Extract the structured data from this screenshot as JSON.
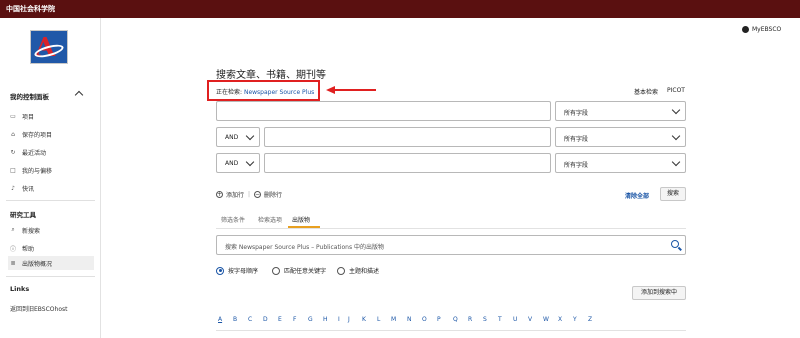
{
  "topbar": {
    "title": "中国社会科学院"
  },
  "sidebar": {
    "sections": [
      {
        "title": "我的控制面板",
        "items": [
          {
            "icon": "list-icon",
            "label": "项目"
          },
          {
            "icon": "bookmark-icon",
            "label": "保存的项目"
          },
          {
            "icon": "history-icon",
            "label": "最近活动"
          },
          {
            "icon": "folder-icon",
            "label": "我的与偏移"
          },
          {
            "icon": "bell-icon",
            "label": "快讯"
          }
        ]
      },
      {
        "title": "研究工具",
        "items": [
          {
            "icon": "search-icon",
            "label": "新搜索"
          },
          {
            "icon": "help-icon",
            "label": "帮助"
          },
          {
            "icon": "publications-icon",
            "label": "出版物概况"
          }
        ]
      }
    ],
    "links_title": "Links",
    "links": [
      "返回到旧EBSCOhost"
    ]
  },
  "header": {
    "myebsco": "MyEBSCO"
  },
  "main": {
    "title": "搜索文章、书籍、期刊等",
    "searching_label": "正在检索:",
    "database": "Newspaper Source Plus",
    "basic_search": "基本检索",
    "picot": "PICOT",
    "rows": [
      {
        "operator": "",
        "text": "",
        "field": "所有字段"
      },
      {
        "operator": "AND",
        "text": "",
        "field": "所有字段"
      },
      {
        "operator": "AND",
        "text": "",
        "field": "所有字段"
      }
    ],
    "add_row": "添加行",
    "remove_row": "删除行",
    "clear_all": "清除全部",
    "search_button": "搜索",
    "tabs": [
      "筛选条件",
      "检索选项",
      "出版物"
    ],
    "pub_search_placeholder": "搜索 Newspaper Source Plus – Publications 中的出版物",
    "radios": [
      "按字母顺序",
      "匹配任意关键字",
      "主题和描述"
    ],
    "add_to_search": "添加到搜索中",
    "alphabet": [
      "A",
      "B",
      "C",
      "D",
      "E",
      "F",
      "G",
      "H",
      "I",
      "J",
      "K",
      "L",
      "M",
      "N",
      "O",
      "P",
      "Q",
      "R",
      "S",
      "T",
      "U",
      "V",
      "W",
      "X",
      "Y",
      "Z"
    ]
  },
  "colors": {
    "topbar": "#5a1010",
    "accent": "#1a55a6",
    "annotation": "#e02020",
    "tab_underline": "#e8a020"
  }
}
